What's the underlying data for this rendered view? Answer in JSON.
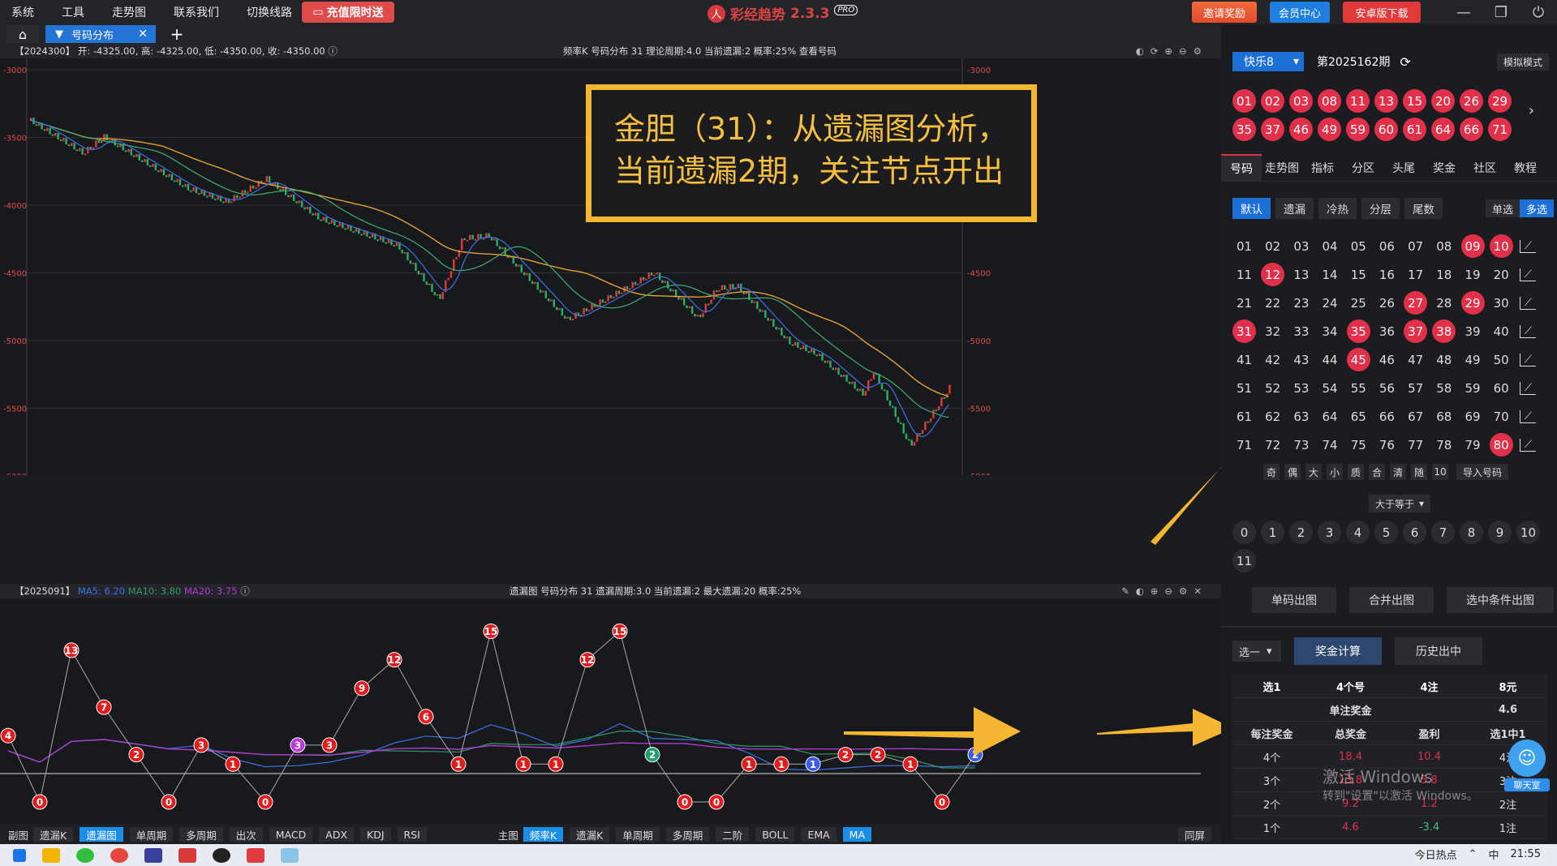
{
  "menu": [
    "系统",
    "工具",
    "走势图",
    "联系我们",
    "切换线路"
  ],
  "recharge": "充值限时送",
  "app": {
    "name": "彩经趋势",
    "version": "2.3.3",
    "badge": "PRO"
  },
  "top_buttons": {
    "reward": "邀请奖励",
    "member": "会员中心",
    "android": "安卓版下载"
  },
  "tab": {
    "label": "号码分布"
  },
  "chart_top": {
    "period": "【2024300】",
    "ohlc": "开: -4325.00, 高: -4325.00, 低: -4350.00, 收: -4350.00",
    "info": "频率K   号码分布   31      理论周期:4.0   当前遗漏:2   概率:25%      查看号码",
    "y_ticks": [
      "-3000",
      "-3500",
      "-4000",
      "-4500",
      "-5000",
      "-5500",
      "-6000"
    ]
  },
  "chart_bottom": {
    "period": "【2025091】",
    "ma5": "MA5: 6.20",
    "ma10": "MA10: 3.80",
    "ma20": "MA20: 3.75",
    "info": "遗漏图   号码分布   31      遗漏周期:3.0   当前遗漏:2   最大遗漏:20   概率:25%"
  },
  "annotation": {
    "line1": "金胆（31）：从遗漏图分析，",
    "line2": "当前遗漏2期，关注节点开出"
  },
  "chart_data": {
    "type": "line",
    "title": "遗漏图 号码分布 31",
    "x": [
      1,
      2,
      3,
      4,
      5,
      6,
      7,
      8,
      9,
      10,
      11,
      12,
      13,
      14,
      15,
      16,
      17,
      18,
      19,
      20,
      21,
      22,
      23,
      24,
      25,
      26,
      27,
      28,
      29,
      30
    ],
    "series": [
      {
        "name": "31",
        "values": [
          4,
          0,
          13,
          7,
          2,
          0,
          3,
          1,
          0,
          3,
          3,
          9,
          12,
          6,
          1,
          15,
          1,
          1,
          12,
          15,
          2,
          0,
          0,
          1,
          1,
          1,
          2,
          2,
          1,
          0,
          2
        ]
      }
    ],
    "ylim": [
      0,
      16
    ]
  },
  "toolbar": {
    "sub_label": "副图",
    "sub_buttons": [
      "遗漏K",
      "遗漏图",
      "单周期",
      "多周期",
      "出次",
      "MACD",
      "ADX",
      "KDJ",
      "RSI"
    ],
    "main_label": "主图",
    "main_buttons": [
      "频率K",
      "遗漏K",
      "单周期",
      "多周期",
      "二阶",
      "BOLL",
      "EMA",
      "MA"
    ],
    "sync": "同屏"
  },
  "side": {
    "lottery": "快乐8",
    "issue": "第2025162期",
    "sim_mode": "模拟模式",
    "draw": [
      "01",
      "02",
      "03",
      "08",
      "11",
      "13",
      "15",
      "20",
      "26",
      "29",
      "35",
      "37",
      "46",
      "49",
      "59",
      "60",
      "61",
      "64",
      "66",
      "71"
    ],
    "tabs": [
      "号码",
      "走势图",
      "指标",
      "分区",
      "头尾",
      "奖金",
      "社区",
      "教程"
    ],
    "modes": [
      "默认",
      "遗漏",
      "冷热",
      "分层",
      "尾数"
    ],
    "single": "单选",
    "multi": "多选",
    "quick": [
      "奇",
      "偶",
      "大",
      "小",
      "质",
      "合",
      "清",
      "随",
      "10"
    ],
    "import": "导入号码",
    "ge": "大于等于",
    "counts": [
      "0",
      "1",
      "2",
      "3",
      "4",
      "5",
      "6",
      "7",
      "8",
      "9",
      "10",
      "11"
    ],
    "actions": [
      "单码出图",
      "合并出图",
      "选中条件出图"
    ],
    "pick": "选一",
    "calc": "奖金计算",
    "history": "历史出中",
    "summary": [
      "选1",
      "4个号",
      "4注",
      "8元"
    ],
    "single_prize_label": "单注奖金",
    "single_prize": "4.6",
    "table_head": [
      "每注奖金",
      "总奖金",
      "盈利",
      "选1中1"
    ],
    "table_rows": [
      [
        "4个",
        "18.4",
        "10.4",
        "4注"
      ],
      [
        "3个",
        "13.8",
        "5.8",
        "3注"
      ],
      [
        "2个",
        "9.2",
        "1.2",
        "2注"
      ],
      [
        "1个",
        "4.6",
        "-3.4",
        "1注"
      ]
    ]
  },
  "watermark": {
    "line1": "激活 Windows",
    "line2": "转到\"设置\"以激活 Windows。"
  },
  "chat": "聊天室",
  "taskbar": {
    "hot": "今日热点",
    "time": "21:55",
    "lang": "中"
  }
}
